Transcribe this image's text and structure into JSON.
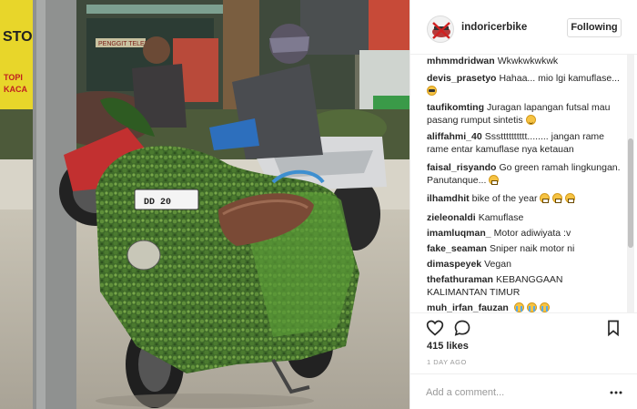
{
  "post": {
    "username": "indoricerbike",
    "follow_label": "Following",
    "likes": "415 likes",
    "date": "1 DAY AGO",
    "comment_placeholder": "Add a comment..."
  },
  "photo": {
    "sign_text_1": "STO",
    "sign_text_2": "TOPI",
    "sign_text_3": "KACA",
    "shop_sign": "PENGGIT TELEN",
    "plate": "DD 20"
  },
  "comments": [
    {
      "user": "mhmmdridwan",
      "text": "Wkwkwkwkwk",
      "emojis": []
    },
    {
      "user": "devis_prasetyo",
      "text": "Hahaa... mio lgi kamuflase...",
      "emojis": [
        "cool"
      ]
    },
    {
      "user": "taufikomting",
      "text": "Juragan lapangan futsal mau pasang rumput sintetis",
      "emojis": [
        "sweat"
      ]
    },
    {
      "user": "aliffahmi_40",
      "text": "Ssstttttttttt........ jangan rame rame entar kamuflase nya ketauan",
      "emojis": []
    },
    {
      "user": "faisal_risyando",
      "text": "Go green ramah lingkungan. Panutanque...",
      "emojis": [
        "grin"
      ]
    },
    {
      "user": "ilhamdhit",
      "text": "bike of the year",
      "emojis": [
        "grin",
        "grin",
        "grin"
      ]
    },
    {
      "user": "zieleonaldi",
      "text": "Kamuflase",
      "emojis": []
    },
    {
      "user": "imamluqman_",
      "text": "Motor adiwiyata :v",
      "emojis": []
    },
    {
      "user": "fake_seaman",
      "text": "Sniper naik motor ni",
      "emojis": []
    },
    {
      "user": "dimaspeyek",
      "text": "Vegan",
      "emojis": []
    },
    {
      "user": "thefathuraman",
      "text": "KEBANGGAAN KALIMANTAN TIMUR",
      "emojis": []
    },
    {
      "user": "muh_irfan_fauzan",
      "text": "",
      "emojis": [
        "cry",
        "cry",
        "cry"
      ]
    }
  ],
  "icons": {
    "like": "heart-icon",
    "comment": "comment-icon",
    "save": "bookmark-icon",
    "more": "more-options-icon"
  }
}
